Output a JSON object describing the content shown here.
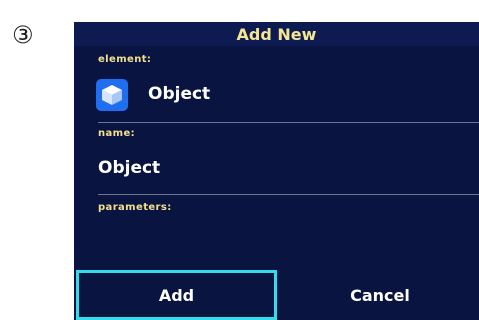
{
  "step_marker": "③",
  "dialog": {
    "title": "Add New",
    "element": {
      "label": "element:",
      "value": "Object",
      "icon": "cube-icon"
    },
    "name": {
      "label": "name:",
      "value": "Object"
    },
    "parameters": {
      "label": "parameters:"
    },
    "buttons": {
      "add": "Add",
      "cancel": "Cancel"
    },
    "colors": {
      "background": "#0a1440",
      "label": "#f3e08e",
      "focus_border": "#33dcec",
      "icon_bg": "#1f6ff0"
    }
  }
}
